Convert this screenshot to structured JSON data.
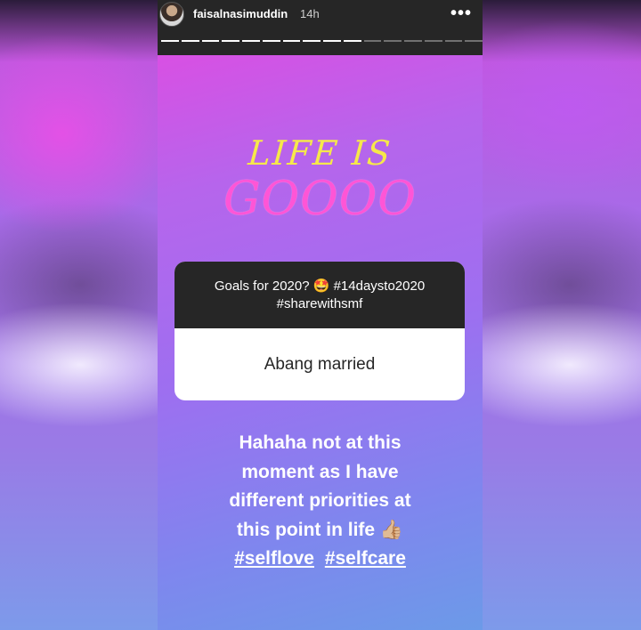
{
  "story": {
    "username": "faisalnasimuddin",
    "time": "14h",
    "more_icon": "more-horizontal-icon",
    "progress": {
      "total_segments": 16,
      "completed_segments": 10
    },
    "title_line1": "LIFE IS",
    "title_line2": "GOOOO",
    "question": {
      "prompt_line1": "Goals for 2020? 🤩 #14daysto2020",
      "prompt_line2": "#sharewithsmf",
      "answer": "Abang married"
    },
    "reply": {
      "lines": [
        "Hahaha not at this",
        "moment as I have",
        "different priorities at",
        "this point in life 👍🏼"
      ],
      "hashtags": [
        "#selflove",
        "#selfcare"
      ]
    }
  }
}
